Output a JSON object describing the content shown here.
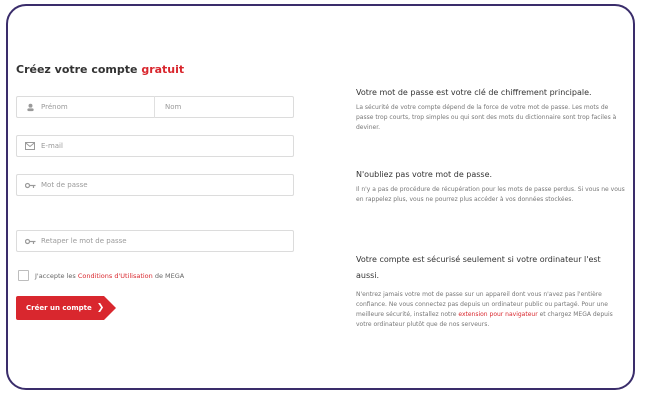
{
  "form": {
    "title_prefix": "Créez votre compte",
    "title_accent": "gratuit",
    "firstname_placeholder": "Prénom",
    "lastname_placeholder": "Nom",
    "email_placeholder": "E-mail",
    "password_placeholder": "Mot de passe",
    "confirm_placeholder": "Retaper le mot de passe",
    "terms_prefix": "J'accepte les",
    "terms_link": "Conditions d'Utilisation",
    "terms_suffix": "de MEGA",
    "submit_label": "Créer un compte",
    "submit_chevron": "❯"
  },
  "info": {
    "heading1": "Votre mot de passe est votre clé de chiffrement principale.",
    "para1": "La sécurité de votre compte dépend de la force de votre mot de passe. Les mots de passe trop courts, trop simples ou qui sont des mots du dictionnaire sont trop faciles à deviner.",
    "heading2": "N'oubliez pas votre mot de passe.",
    "para2": "Il n'y a pas de procédure de récupération pour les mots de passe perdus. Si vous ne vous en rappelez plus, vous ne pourrez plus accéder à vos données stockées.",
    "heading3": "Votre compte est sécurisé seulement si votre ordinateur l'est aussi.",
    "para3_a": "N'entrez jamais votre mot de passe sur un appareil dont vous n'avez pas l'entière confiance. Ne vous connectez pas depuis un ordinateur public ou partagé. Pour une meilleure sécurité, installez notre",
    "para3_link": "extension pour navigateur",
    "para3_b": "et chargez MEGA depuis votre ordinateur plutôt que de nos serveurs."
  },
  "colors": {
    "accent": "#d9272e",
    "frame": "#3a2d6b"
  }
}
